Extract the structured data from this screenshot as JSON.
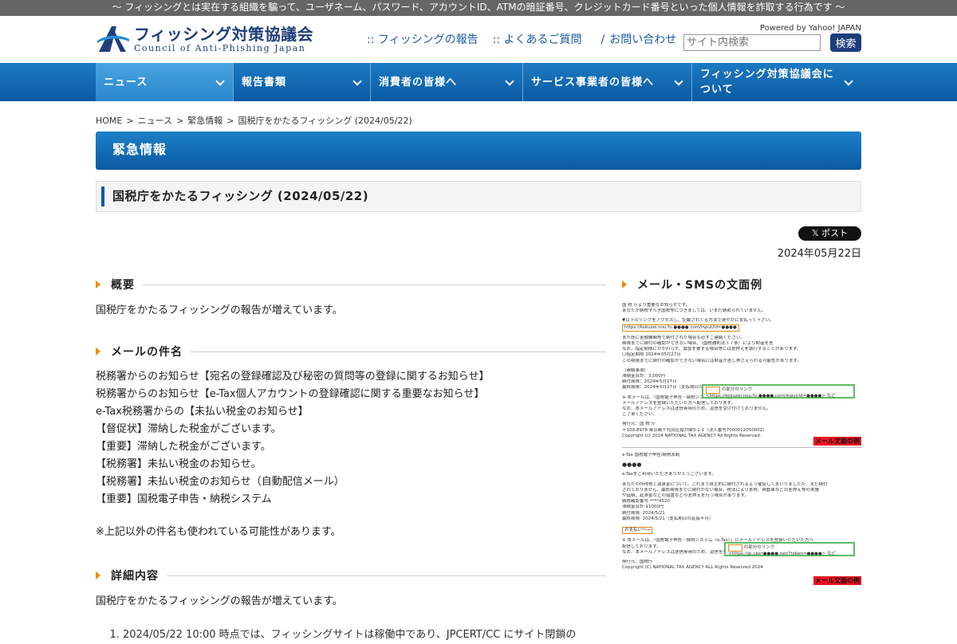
{
  "topbar": {
    "text": "〜 フィッシングとは実在する組織を騙って、ユーザネーム、パスワード、アカウントID、ATMの暗証番号、クレジットカード番号といった個人情報を詐取する行為です 〜"
  },
  "header": {
    "logo_jp": "フィッシング対策協議会",
    "logo_en": "Council of Anti-Phishing Japan",
    "links": [
      ":: フィッシングの報告",
      ":: よくあるご質問",
      "/",
      "お問い合わせ"
    ],
    "powered": "Powered by Yahoo! JAPAN",
    "search_placeholder": "サイト内検索",
    "search_button": "検索"
  },
  "nav": {
    "items": [
      "ニュース",
      "報告書類",
      "消費者の皆様へ",
      "サービス事業者の皆様へ",
      "フィッシング対策協議会について"
    ]
  },
  "breadcrumb": [
    "HOME",
    "ニュース",
    "緊急情報",
    "国税庁をかたるフィッシング (2024/05/22)"
  ],
  "category": "緊急情報",
  "title": "国税庁をかたるフィッシング (2024/05/22)",
  "post_button": "𝕏 ポスト",
  "date": "2024年05月22日",
  "sections": {
    "overview": {
      "heading": "概要",
      "text": "国税庁をかたるフィッシングの報告が増えています。"
    },
    "subjects": {
      "heading": "メールの件名",
      "items": [
        "税務署からのお知らせ【宛名の登録確認及び秘密の質問等の登録に関するお知らせ】",
        "税務署からのお知らせ【e-Tax個人アカウントの登録確認に関する重要なお知らせ】",
        "e-Tax税務署からの【未払い税金のお知らせ】",
        "【督促状】滞納した税金がございます。",
        "【重要】滞納した税金がございます。",
        "【税務署】未払い税金のお知らせ。",
        "【税務署】未払い税金のお知らせ（自動配信メール）",
        "【重要】国税電子申告・納税システム"
      ],
      "note": "※上記以外の件名も使われている可能性があります。"
    },
    "details": {
      "heading": "詳細内容",
      "text": "国税庁をかたるフィッシングの報告が増えています。",
      "list_item_1": "2024/05/22 10:00 時点では、フィッシングサイトは稼働中であり、JPCERT/CC にサイト閉鎖の"
    }
  },
  "sidebar": {
    "heading": "メール・SMSの文面例",
    "mail1": {
      "lines": [
        "国 税 庁より重要なお知らせです。",
        "あなたが納税すべき国税等につきましては、いまだ納められていません。",
        "",
        "▼以下のリンクをアクセスし、記載されてる方法で速やかに支払って下さい。",
        "https://kokuzei.nou.fu.●●●●.com/input/id=●●●●",
        "",
        "また既に金融機関等で納付された場合も必ずご連絡ください。",
        "期限までに納付の確認ができない場合、（国税通則法３７条）により財産を差",
        "なお、指定期限にかかわらず、緊急を要する場合等には差押えを執行することがあります。",
        "〇指定期限 2024年05月27日",
        "この期限までに納付の確認ができない場合には財産が差し押さえられる可能性があります。",
        "",
        "（連絡事項）",
        "滞納金合計：3,000円",
        "納付期限：2024年5月17日",
        "最終期限：2024年5月27日（支払期日の延長不可）",
        "",
        "※ 本メールは、「国税電子申告・納税システム（e-Tax）」に",
        "メールアドレスを登録いただいた方へ配信しております。",
        "なお、本メールアドレスは送信専用のため、返信を受け付けておりません。",
        "ご了承ください。",
        "",
        "発行元：国 税 庁",
        "〒100-8978 東京都千代田区霞が関3-1-1（法人番号7000012050002）",
        "Copyright (c) 2024 NATIONAL TAX AGENCY All Rights Reserved."
      ],
      "link_label": "の部分のリンク",
      "link_url": "<https://kokuzei.nou.fu.●●●●.com/input/id=●●●●> など",
      "tag": "メール文面の例"
    },
    "mail2": {
      "lines": [
        "e-Tax 国税電子申告/納税系統",
        "",
        "●●●●",
        "",
        "e-Taxをご利用いただきありがとうございます。",
        "",
        "あなたの所得税と源泉金について、これまで自主的に納付されるよう催促してまいりましたが、まだ納付",
        "されておりません。最終期限までに納付がない場合、税法により本税、自動車などの差押え等の実施",
        "や延納、延滞金などの措置などの差押えを行う場合があります。",
        "納税確認番号:****4520",
        "滞納金合計:$1000円",
        "納付期限: 2024/5/21",
        "最終期限: 2024/5/21（支払期日の延長不可）"
      ],
      "pay_button": "お支払いへ→",
      "link_label": "の部分のリンク",
      "link_url": "<https://jp.uber●●●●.net/?token=●●●●> など",
      "footer_lines": [
        "※ 本メールは、「国税電子申告・納税システム（e-Tax）」にメールアドレスを登録いただいた方へ",
        "配信しております。",
        "なお、本メールアドレスは送信専用のため、返信を受け付けておりません。ご了承ください。",
        "",
        "発行元：国税庁",
        "Copyright (C) NATIONAL TAX AGENCY ALL Rights Reserved.2024"
      ],
      "tag": "メール文面の例"
    }
  },
  "colors": {
    "accent": "#0a5aa3",
    "marker": "#f08c00",
    "topbar": "#666666"
  }
}
